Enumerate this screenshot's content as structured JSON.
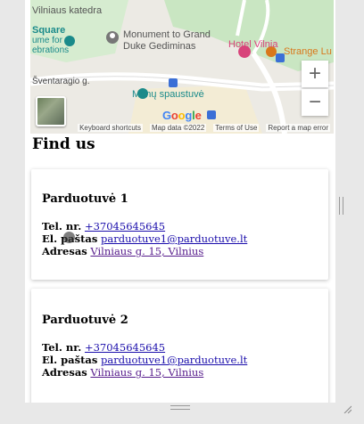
{
  "map": {
    "labels": {
      "katedra": "Vilniaus katedra",
      "square": "Square",
      "square_sub1": "ume for",
      "square_sub2": "ebrations",
      "monument1": "Monument to Grand",
      "monument2": "Duke Gediminas",
      "hotel": "Hotel Vilnia",
      "strange": "Strange Lu",
      "street": "Šventaragio g.",
      "spaustuve": "Menų spaustuvė"
    },
    "zoom_in": "+",
    "zoom_out": "−",
    "google": [
      "G",
      "o",
      "o",
      "g",
      "l",
      "e"
    ],
    "attribution": {
      "shortcuts": "Keyboard shortcuts",
      "mapdata": "Map data ©2022",
      "terms": "Terms of Use",
      "report": "Report a map error"
    }
  },
  "heading": "Find us",
  "cards": [
    {
      "title": "Parduotuvė 1",
      "phone_label": "Tel. nr.",
      "phone": "+37045645645",
      "email_label": "El. paštas",
      "email": "parduotuve1@parduotuve.lt",
      "address_label": "Adresas",
      "address": "Vilniaus g. 15, Vilnius"
    },
    {
      "title": "Parduotuvė 2",
      "phone_label": "Tel. nr.",
      "phone": "+37045645645",
      "email_label": "El. paštas",
      "email": "parduotuve1@parduotuve.lt",
      "address_label": "Adresas",
      "address": "Vilniaus g. 15, Vilnius"
    }
  ],
  "colors": {
    "link": "#1a0dab",
    "visited_link": "#551a8b",
    "map_teal": "#1a8a8a",
    "map_pink": "#d8437a",
    "map_orange": "#d9781b"
  }
}
